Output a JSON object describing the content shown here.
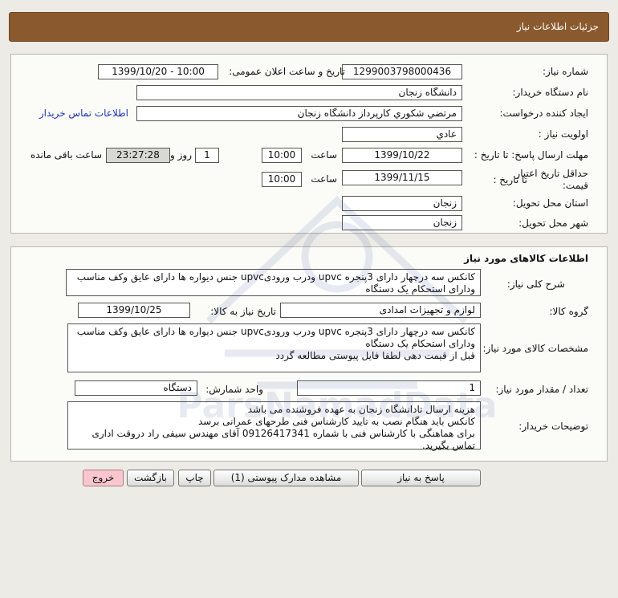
{
  "header": {
    "title": "جزئیات اطلاعات نیاز"
  },
  "details": {
    "need_number_label": "شماره نیاز:",
    "need_number": "1299003798000436",
    "announce_label": "تاریخ و ساعت اعلان عمومی:",
    "announce_value": "1399/10/20 - 10:00",
    "buyer_label": "نام دستگاه خریدار:",
    "buyer_value": "دانشگاه زنجان",
    "creator_label": "ایجاد کننده درخواست:",
    "creator_value": "مرتضي شكوري كارپرداز دانشگاه زنجان",
    "contact_link": "اطلاعات تماس خریدار",
    "priority_label": "اولویت نیاز :",
    "priority_value": "عادي",
    "deadline_label": "مهلت ارسال پاسخ: تا تاریخ :",
    "deadline_date": "1399/10/22",
    "time_label": "ساعت",
    "deadline_time": "10:00",
    "days_value": "1",
    "days_label": "روز و",
    "remaining_time": "23:27:28",
    "remaining_label": "ساعت باقی مانده",
    "validity_label_1": "حداقل تاریخ اعتبار",
    "validity_label_2": "قیمت:",
    "validity_until_label": "تا تاریخ :",
    "validity_date": "1399/11/15",
    "validity_time_label": "ساعت",
    "validity_time": "10:00",
    "province_label": "استان محل تحویل:",
    "province_value": "زنجان",
    "city_label": "شهر محل تحویل:",
    "city_value": "زنجان"
  },
  "goods": {
    "section_title": "اطلاعات کالاهای مورد نیاز",
    "summary_label": "شرح کلی نیاز:",
    "summary_value": "کانکس سه درچهار دارای 3پنجره  upvc  ودرب ورودیupvc جنس دیواره ها دارای عایق وکف مناسب ودارای استحکام یک دستگاه",
    "group_label": "گروه کالا:",
    "group_value": "لوازم و تجهیزات امدادی",
    "need_date_label": "تاریخ نیاز به کالا:",
    "need_date_value": "1399/10/25",
    "spec_label": "مشخصات کالای مورد نیاز:",
    "spec_value": "کانکس سه درچهار دارای 3پنجره  upvc  ودرب ورودیupvc جنس دیواره ها دارای عایق وکف مناسب ودارای استحکام یک دستگاه\nقبل از قیمت دهی لطفا فایل پیوستی مطالعه گردد",
    "qty_label": "تعداد / مقدار مورد نیاز:",
    "qty_value": "1",
    "unit_label": "واحد شمارش:",
    "unit_value": "دستگاه",
    "buyer_notes_label": "توضیحات خریدار:",
    "buyer_notes_value": "هزینه ارسال تادانشگاه زنجان به عهده فروشنده می باشد\nکانکس باید هنگام نصب به تایید کارشناس فنی طرحهای عمرانی برسد\nبرای هماهنگی با کارشناس فنی با شماره 09126417341 آقای مهندس سیفی راد دروقت اداری تماس بگیرید."
  },
  "buttons": {
    "reply": "پاسخ به نیاز",
    "attachments": "مشاهده مدارک پیوستی (1)",
    "print": "چاپ",
    "back": "بازگشت",
    "exit": "خروج"
  },
  "watermark": {
    "text": "ParsNamadData"
  },
  "colors": {
    "header_bg": "#8a5a2e",
    "link": "#1a35b5",
    "exit_button": "#f9c6ce"
  }
}
